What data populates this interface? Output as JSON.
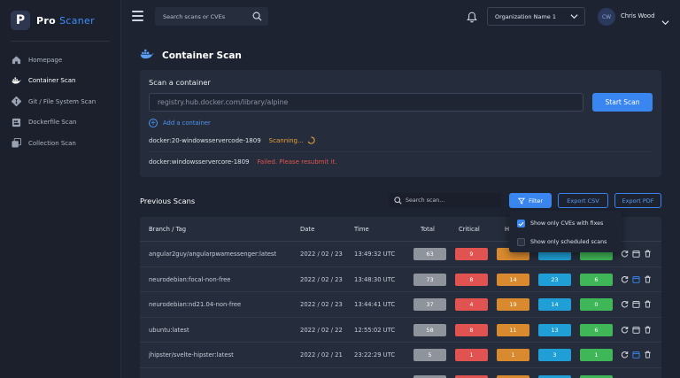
{
  "app": {
    "logo_letter": "P",
    "name_part1": "Pro",
    "name_part2": "Scaner"
  },
  "sidebar": {
    "items": [
      {
        "label": "Homepage",
        "icon": "home-icon"
      },
      {
        "label": "Container Scan",
        "icon": "docker-icon",
        "active": true
      },
      {
        "label": "Git / File System Scan",
        "icon": "git-icon"
      },
      {
        "label": "Dockerfile Scan",
        "icon": "dockerfile-icon"
      },
      {
        "label": "Collection Scan",
        "icon": "collection-icon"
      }
    ]
  },
  "topbar": {
    "search_placeholder": "Search scans or CVEs",
    "org_name": "Organization Name 1",
    "user_initials": "CW",
    "user_name": "Chris Wood"
  },
  "page": {
    "title": "Container Scan"
  },
  "scan_card": {
    "title": "Scan a container",
    "input_placeholder": "registry.hub.docker.com/library/alpine",
    "start_label": "Start Scan",
    "add_label": "Add a container",
    "containers": [
      {
        "name": "docker:20-windowsservercode-1809",
        "status": "Scanning...",
        "state": "scanning"
      },
      {
        "name": "docker:windowsservercore-1809",
        "status": "Failed. Please resubmit it.",
        "state": "failed"
      }
    ]
  },
  "previous": {
    "title": "Previous Scans",
    "search_placeholder": "Search scan...",
    "filter_label": "Filter",
    "export_csv_label": "Export CSV",
    "export_pdf_label": "Export PDF"
  },
  "filter_menu": {
    "items": [
      {
        "label": "Show only CVEs with fixes",
        "checked": true
      },
      {
        "label": "Show only scheduled scans",
        "checked": false
      }
    ]
  },
  "table": {
    "headers": {
      "branch": "Branch / Tag",
      "date": "Date",
      "time": "Time",
      "total": "Total",
      "critical": "Critical",
      "high": "H"
    },
    "rows": [
      {
        "branch": "angular2guy/angularpwamessenger:latest",
        "date": "2022 / 02 / 23",
        "time": "13:49:32 UTC",
        "total": "63",
        "critical": "9",
        "high": "",
        "medium": "",
        "low": "",
        "scheduled": false
      },
      {
        "branch": "neurodebian:focal-non-free",
        "date": "2022 / 02 / 23",
        "time": "13:48:30 UTC",
        "total": "73",
        "critical": "8",
        "high": "14",
        "medium": "23",
        "low": "6",
        "scheduled": true
      },
      {
        "branch": "neurodebian:nd21.04-non-free",
        "date": "2022 / 02 / 23",
        "time": "13:44:41 UTC",
        "total": "37",
        "critical": "4",
        "high": "19",
        "medium": "14",
        "low": "0",
        "scheduled": false
      },
      {
        "branch": "ubuntu:latest",
        "date": "2022 / 02 / 22",
        "time": "12:55:02 UTC",
        "total": "58",
        "critical": "8",
        "high": "11",
        "medium": "13",
        "low": "6",
        "scheduled": false
      },
      {
        "branch": "jhipster/svelte-hipster:latest",
        "date": "2022 / 02 / 21",
        "time": "23:22:29 UTC",
        "total": "5",
        "critical": "1",
        "high": "1",
        "medium": "3",
        "low": "1",
        "scheduled": true
      }
    ]
  },
  "colors": {
    "accent": "#3a86f0",
    "critical": "#e05350",
    "high": "#d98a2e",
    "medium": "#1f9fd6",
    "low": "#3fb657",
    "total": "#8e939c"
  }
}
